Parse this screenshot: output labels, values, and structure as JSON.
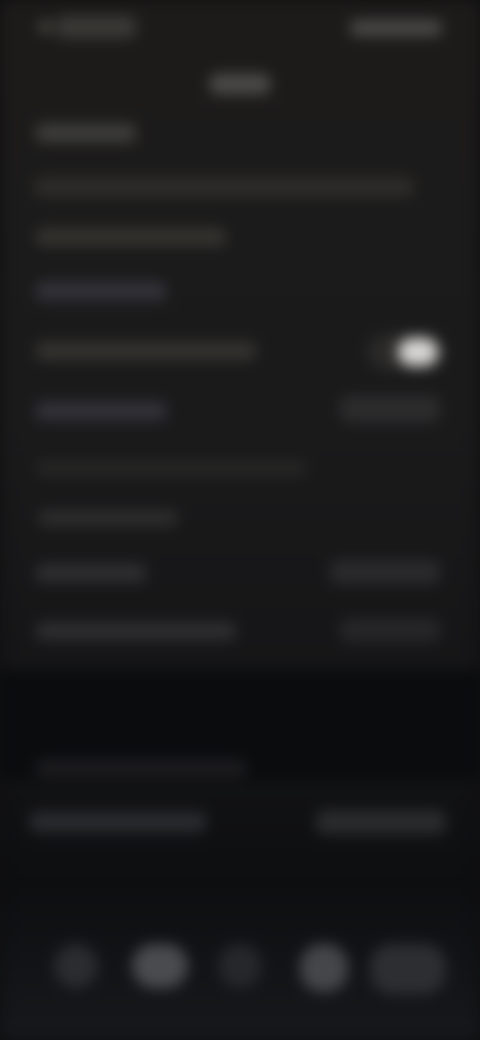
{
  "screen": {
    "status_bar": {
      "time": "",
      "indicators": ""
    },
    "title": "",
    "rows": [
      {
        "label": ""
      },
      {
        "label": ""
      },
      {
        "label": ""
      },
      {
        "label": ""
      },
      {
        "label": "",
        "toggle_on": true
      },
      {
        "label": ""
      },
      {
        "label": ""
      },
      {
        "label": ""
      },
      {
        "label": ""
      },
      {
        "label": ""
      },
      {
        "label": ""
      },
      {
        "label": ""
      }
    ],
    "bottom_nav": {
      "items": [
        {
          "icon": "home-icon",
          "label": ""
        },
        {
          "icon": "grid-icon",
          "label": ""
        },
        {
          "icon": "plus-icon",
          "label": ""
        },
        {
          "icon": "chat-icon",
          "label": ""
        },
        {
          "icon": "profile-icon",
          "label": ""
        }
      ]
    }
  }
}
